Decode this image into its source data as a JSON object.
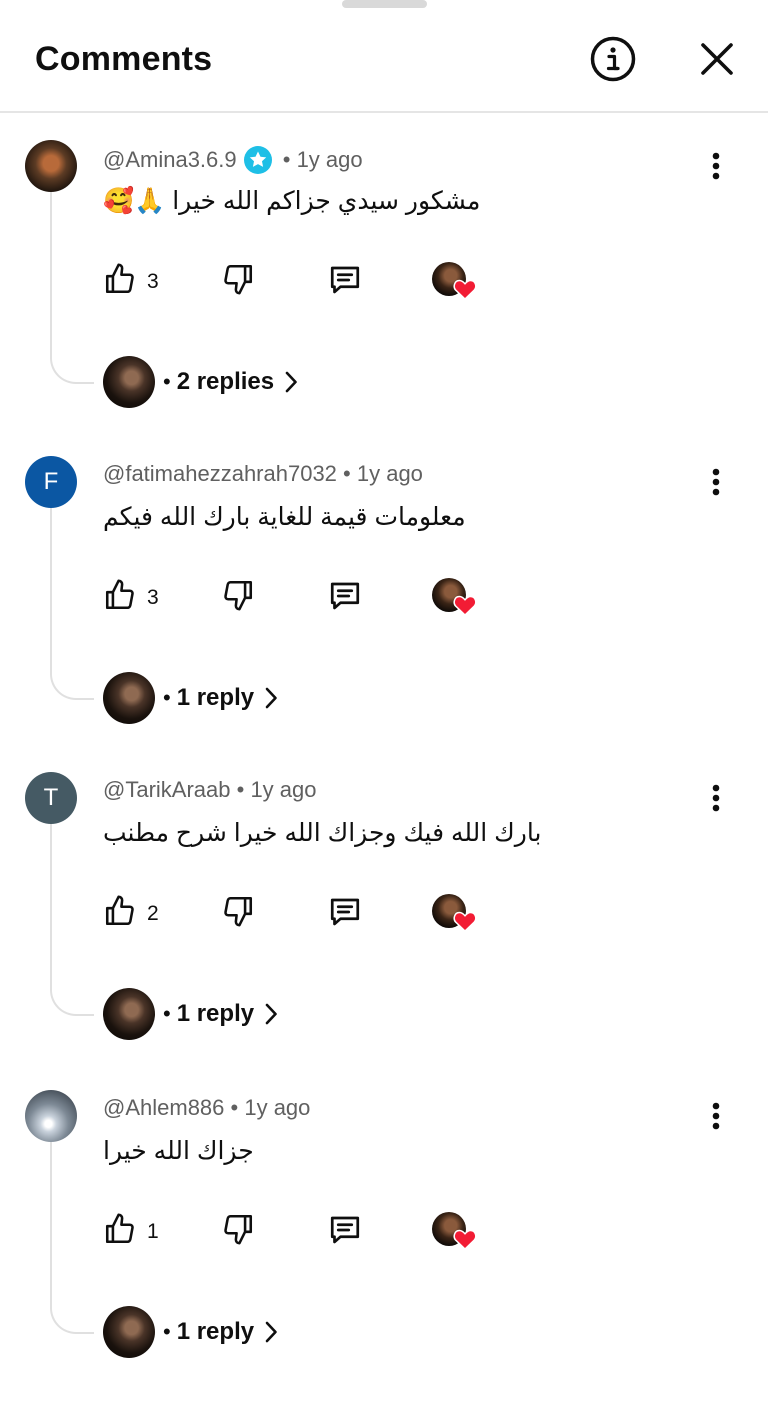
{
  "header": {
    "title": "Comments"
  },
  "comments": [
    {
      "handle": "@Amina3.6.9",
      "verified_badge": true,
      "time": "1y ago",
      "text_ar": "مشكور سيدي جزاكم الله خيرا",
      "text_emoji": "🥰🙏",
      "likes": "3",
      "replies_label": "2 replies",
      "avatar_letter": "",
      "avatar_color": "#3b2b1f"
    },
    {
      "handle": "@fatimahezzahrah7032",
      "verified_badge": false,
      "time": "1y ago",
      "text_ar": "معلومات قيمة للغاية بارك الله فيكم",
      "text_emoji": "",
      "likes": "3",
      "replies_label": "1 reply",
      "avatar_letter": "F",
      "avatar_color": "#0b57a3"
    },
    {
      "handle": "@TarikAraab",
      "verified_badge": false,
      "time": "1y ago",
      "text_ar": "بارك الله فيك وجزاك الله خيرا شرح مطنب",
      "text_emoji": "",
      "likes": "2",
      "replies_label": "1 reply",
      "avatar_letter": "T",
      "avatar_color": "#455a64"
    },
    {
      "handle": "@Ahlem886",
      "verified_badge": false,
      "time": "1y ago",
      "text_ar": "جزاك الله خيرا",
      "text_emoji": "",
      "likes": "1",
      "replies_label": "1 reply",
      "avatar_letter": "",
      "avatar_color": "#6b7a89"
    }
  ]
}
